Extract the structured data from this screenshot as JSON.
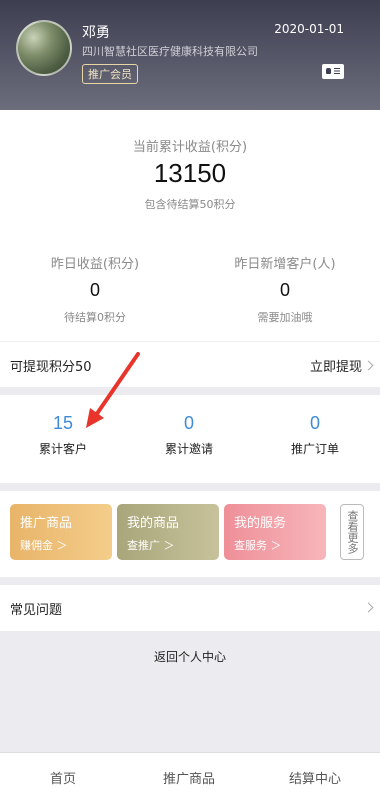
{
  "header": {
    "user_name": "邓勇",
    "company": "四川智慧社区医疗健康科技有限公司",
    "member_badge": "推广会员",
    "date": "2020-01-01",
    "card_icon": "id-card-icon"
  },
  "income": {
    "current_label": "当前累计收益(积分)",
    "current_value": "13150",
    "pending_note": "包含待结算50积分",
    "yesterday_label": "昨日收益(积分)",
    "yesterday_value": "0",
    "yesterday_pending": "待结算0积分",
    "new_customers_label": "昨日新增客户(人)",
    "new_customers_value": "0",
    "new_customers_note": "需要加油哦"
  },
  "withdraw": {
    "available": "可提现积分50",
    "action": "立即提现"
  },
  "stats": [
    {
      "value": "15",
      "label": "累计客户"
    },
    {
      "value": "0",
      "label": "累计邀请"
    },
    {
      "value": "0",
      "label": "推广订单"
    }
  ],
  "tiles": [
    {
      "title": "推广商品",
      "sub": "赚佣金 ＞",
      "color": "#f0c07a"
    },
    {
      "title": "我的商品",
      "sub": "查推广 ＞",
      "color": "#b5b287"
    },
    {
      "title": "我的服务",
      "sub": "查服务 ＞",
      "color": "#f3a2a9"
    }
  ],
  "more_label": "查看更多",
  "faq_label": "常见问题",
  "back_label": "返回个人中心",
  "tabbar": [
    "首页",
    "推广商品",
    "结算中心"
  ],
  "accent": "#3f8bd9",
  "annotation_color": "#e8342a"
}
